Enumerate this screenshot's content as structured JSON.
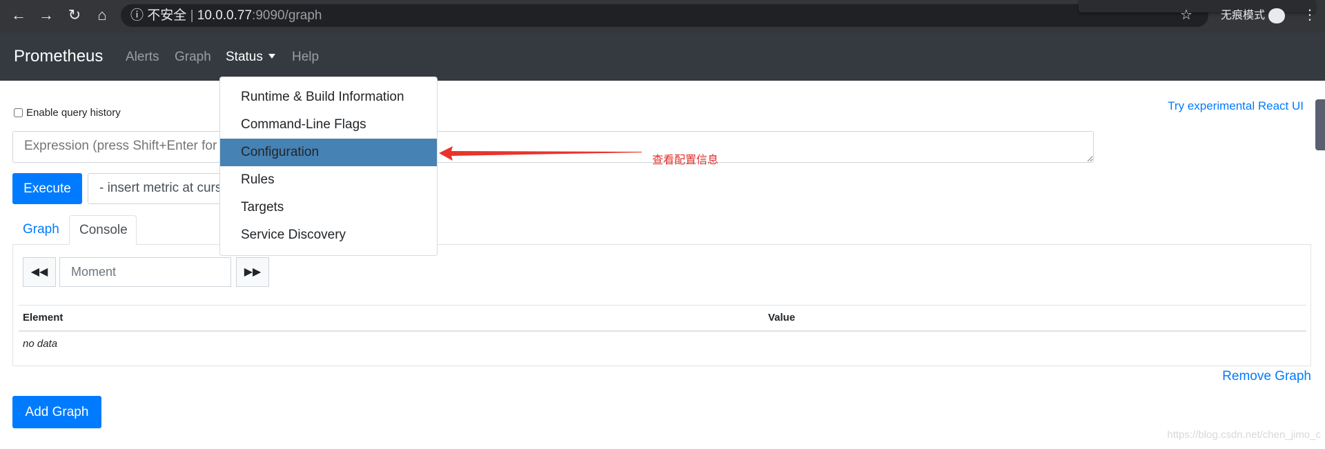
{
  "browser": {
    "security_label": "不安全",
    "url_host": "10.0.0.77",
    "url_rest": ":9090/graph",
    "incognito_label": "无痕模式",
    "icons": [
      "back-icon",
      "forward-icon",
      "reload-icon",
      "home-icon",
      "info-icon",
      "star-icon",
      "incognito-icon",
      "more-icon"
    ]
  },
  "navbar": {
    "brand": "Prometheus",
    "items": [
      {
        "label": "Alerts"
      },
      {
        "label": "Graph"
      },
      {
        "label": "Status"
      },
      {
        "label": "Help"
      }
    ]
  },
  "status_menu": {
    "items": [
      {
        "label": "Runtime & Build Information"
      },
      {
        "label": "Command-Line Flags"
      },
      {
        "label": "Configuration",
        "highlighted": true
      },
      {
        "label": "Rules"
      },
      {
        "label": "Targets"
      },
      {
        "label": "Service Discovery"
      }
    ],
    "highlight_color": "#4682b4"
  },
  "annotation": {
    "text": "查看配置信息",
    "color": "#e0302a"
  },
  "page": {
    "enable_history_label": "Enable query history",
    "enable_history_checked": false,
    "react_ui_link": "Try experimental React UI",
    "expression_placeholder": "Expression (press Shift+Enter for newlines)",
    "execute_label": "Execute",
    "insert_metric_label": "- insert metric at cursor -",
    "tabs": [
      {
        "label": "Graph"
      },
      {
        "label": "Console",
        "active": true
      }
    ],
    "moment_placeholder": "Moment",
    "table": {
      "headers": [
        "Element",
        "Value"
      ],
      "empty_text": "no data"
    },
    "remove_graph_label": "Remove Graph",
    "add_graph_label": "Add Graph"
  },
  "watermark": "https://blog.csdn.net/chen_jimo_c",
  "colors": {
    "primary": "#007bff",
    "navbar": "#343a40"
  }
}
